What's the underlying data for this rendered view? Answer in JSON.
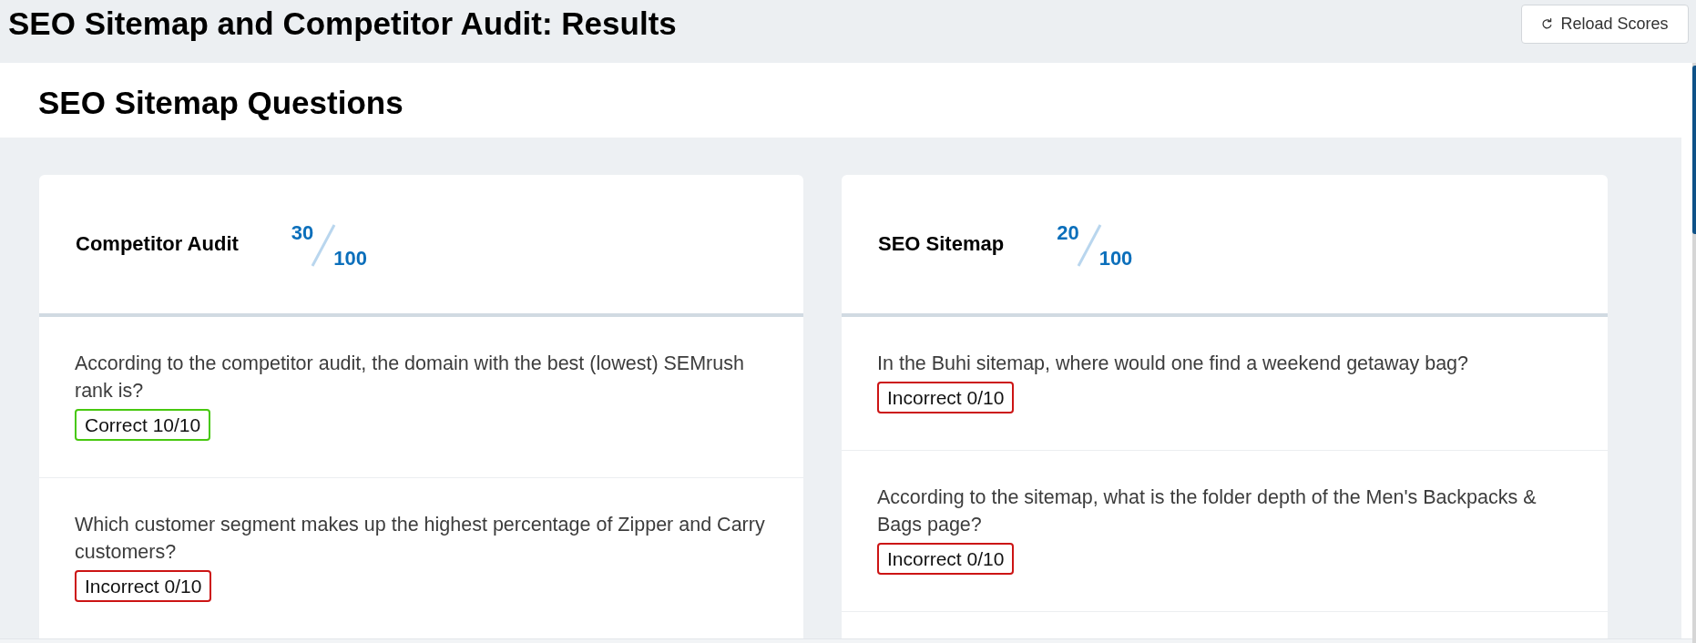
{
  "page_title": "SEO Sitemap and Competitor Audit: Results",
  "reload_button": {
    "label": "Reload Scores"
  },
  "section": {
    "title": "SEO Sitemap Questions"
  },
  "cards": [
    {
      "title": "Competitor Audit",
      "score": "30",
      "max_score": "100",
      "questions": [
        {
          "text": "According to the competitor audit, the domain with the best (lowest) SEMrush rank is?",
          "result": {
            "kind": "correct",
            "label": "Correct 10/10"
          }
        },
        {
          "text": "Which customer segment makes up the highest percentage of Zipper and Carry customers?",
          "result": {
            "kind": "incorrect",
            "label": "Incorrect 0/10"
          }
        }
      ]
    },
    {
      "title": "SEO Sitemap",
      "score": "20",
      "max_score": "100",
      "questions": [
        {
          "text": "In the Buhi sitemap, where would one find a weekend getaway bag?",
          "result": {
            "kind": "incorrect",
            "label": "Incorrect 0/10"
          }
        },
        {
          "text": "According to the sitemap, what is the folder depth of the Men's Backpacks & Bags page?",
          "result": {
            "kind": "incorrect",
            "label": "Incorrect 0/10"
          }
        }
      ]
    }
  ]
}
